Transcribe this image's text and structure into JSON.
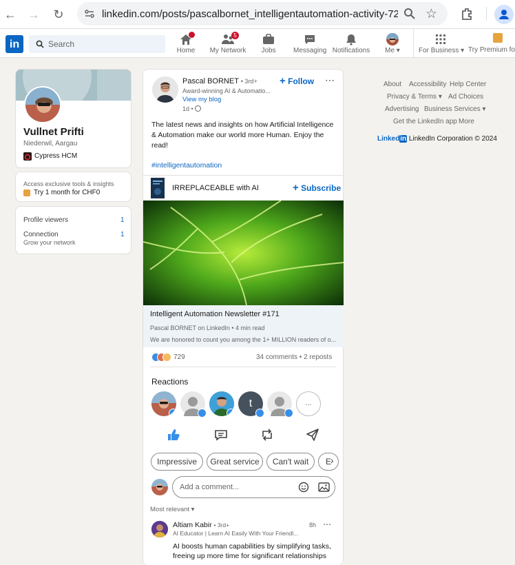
{
  "browser": {
    "url": "linkedin.com/posts/pascalbornet_intelligentautomation-activity-72..."
  },
  "nav": {
    "search_placeholder": "Search",
    "items": [
      {
        "label": "Home",
        "badge": "•"
      },
      {
        "label": "My Network",
        "badge": "5"
      },
      {
        "label": "Jobs",
        "badge": ""
      },
      {
        "label": "Messaging",
        "badge": ""
      },
      {
        "label": "Notifications",
        "badge": ""
      },
      {
        "label": "Me ▾",
        "badge": ""
      },
      {
        "label": "For Business ▾",
        "badge": ""
      },
      {
        "label": "Try Premium for C",
        "badge": ""
      }
    ]
  },
  "profile": {
    "name": "Vullnet Prifti",
    "location": "Niederwil, Aargau",
    "company": "Cypress HCM",
    "premium_teaser": "Access exclusive tools & insights",
    "premium_offer": "Try 1 month for CHF0",
    "profile_viewers_label": "Profile viewers",
    "profile_viewers_count": "1",
    "connection_label": "Connection",
    "connection_count": "1",
    "grow_network": "Grow your network"
  },
  "post": {
    "author_name": "Pascal BORNET",
    "author_degree": "• 3rd+",
    "author_headline": "Award-winning AI & Automatio...",
    "view_blog": "View my blog",
    "time": "1d •",
    "follow_label": "Follow",
    "body": "The latest news and insights on how Artificial Intelligence & Automation make our world more Human. Enjoy the read!",
    "hashtag": "#intelligentautomation",
    "newsletter_name": "IRREPLACEABLE with AI",
    "subscribe_label": "Subscribe",
    "article_title": "Intelligent Automation Newsletter #171",
    "article_meta": "Pascal BORNET on LinkedIn • 4 min read",
    "article_snippet": "We are honored to count you among the 1+ MILLION readers of o...",
    "reaction_count": "729",
    "comments_reposts": "34 comments • 2 reposts",
    "reactions_heading": "Reactions",
    "more_reactors": "...",
    "quick_replies": [
      "Impressive",
      "Great service",
      "Can't wait",
      "E"
    ],
    "comment_placeholder": "Add a comment...",
    "sort_label": "Most relevant ▾"
  },
  "comment": {
    "author": "Altiam Kabir",
    "degree": "• 3rd+",
    "headline": "AI Educator | Learn AI Easily With Your Friendl...",
    "time": "8h",
    "text_line1": "AI boosts human capabilities by simplifying tasks,",
    "text_line2": "freeing up more time for significant relationships"
  },
  "footer": {
    "about": "About",
    "accessibility": "Accessibility",
    "help": "Help Center",
    "privacy": "Privacy & Terms ▾",
    "ad_choices": "Ad Choices",
    "advertising": "Advertising",
    "business_services": "Business Services ▾",
    "get_app": "Get the LinkedIn app",
    "more": "More",
    "brand_word": "Linked",
    "brand_in": "in",
    "copyright": "LinkedIn Corporation © 2024"
  },
  "colors": {
    "brand": "#0a66c2",
    "page_bg": "#f4f2ee",
    "badge_red": "#cb112d"
  }
}
